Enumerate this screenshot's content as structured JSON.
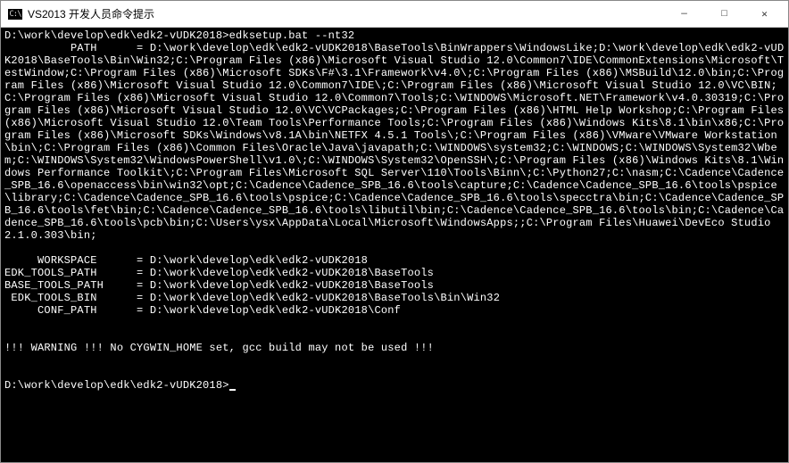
{
  "window": {
    "icon_label": "C:\\",
    "title": "VS2013 开发人员命令提示"
  },
  "controls": {
    "minimize": "—",
    "maximize": "□",
    "close": "✕"
  },
  "terminal": {
    "line_command": "D:\\work\\develop\\edk\\edk2-vUDK2018>edksetup.bat --nt32",
    "path_label": "          PATH      = ",
    "path_value": "D:\\work\\develop\\edk\\edk2-vUDK2018\\BaseTools\\BinWrappers\\WindowsLike;D:\\work\\develop\\edk\\edk2-vUDK2018\\BaseTools\\Bin\\Win32;C:\\Program Files (x86)\\Microsoft Visual Studio 12.0\\Common7\\IDE\\CommonExtensions\\Microsoft\\TestWindow;C:\\Program Files (x86)\\Microsoft SDKs\\F#\\3.1\\Framework\\v4.0\\;C:\\Program Files (x86)\\MSBuild\\12.0\\bin;C:\\Program Files (x86)\\Microsoft Visual Studio 12.0\\Common7\\IDE\\;C:\\Program Files (x86)\\Microsoft Visual Studio 12.0\\VC\\BIN;C:\\Program Files (x86)\\Microsoft Visual Studio 12.0\\Common7\\Tools;C:\\WINDOWS\\Microsoft.NET\\Framework\\v4.0.30319;C:\\Program Files (x86)\\Microsoft Visual Studio 12.0\\VC\\VCPackages;C:\\Program Files (x86)\\HTML Help Workshop;C:\\Program Files (x86)\\Microsoft Visual Studio 12.0\\Team Tools\\Performance Tools;C:\\Program Files (x86)\\Windows Kits\\8.1\\bin\\x86;C:\\Program Files (x86)\\Microsoft SDKs\\Windows\\v8.1A\\bin\\NETFX 4.5.1 Tools\\;C:\\Program Files (x86)\\VMware\\VMware Workstation\\bin\\;C:\\Program Files (x86)\\Common Files\\Oracle\\Java\\javapath;C:\\WINDOWS\\system32;C:\\WINDOWS;C:\\WINDOWS\\System32\\Wbem;C:\\WINDOWS\\System32\\WindowsPowerShell\\v1.0\\;C:\\WINDOWS\\System32\\OpenSSH\\;C:\\Program Files (x86)\\Windows Kits\\8.1\\Windows Performance Toolkit\\;C:\\Program Files\\Microsoft SQL Server\\110\\Tools\\Binn\\;C:\\Python27;C:\\nasm;C:\\Cadence\\Cadence_SPB_16.6\\openaccess\\bin\\win32\\opt;C:\\Cadence\\Cadence_SPB_16.6\\tools\\capture;C:\\Cadence\\Cadence_SPB_16.6\\tools\\pspice\\library;C:\\Cadence\\Cadence_SPB_16.6\\tools\\pspice;C:\\Cadence\\Cadence_SPB_16.6\\tools\\specctra\\bin;C:\\Cadence\\Cadence_SPB_16.6\\tools\\fet\\bin;C:\\Cadence\\Cadence_SPB_16.6\\tools\\libutil\\bin;C:\\Cadence\\Cadence_SPB_16.6\\tools\\bin;C:\\Cadence\\Cadence_SPB_16.6\\tools\\pcb\\bin;C:\\Users\\ysx\\AppData\\Local\\Microsoft\\WindowsApps;;C:\\Program Files\\Huawei\\DevEco Studio 2.1.0.303\\bin;",
    "env": [
      {
        "label": "     WORKSPACE      = ",
        "value": "D:\\work\\develop\\edk\\edk2-vUDK2018"
      },
      {
        "label": "EDK_TOOLS_PATH      = ",
        "value": "D:\\work\\develop\\edk\\edk2-vUDK2018\\BaseTools"
      },
      {
        "label": "BASE_TOOLS_PATH     = ",
        "value": "D:\\work\\develop\\edk\\edk2-vUDK2018\\BaseTools"
      },
      {
        "label": " EDK_TOOLS_BIN      = ",
        "value": "D:\\work\\develop\\edk\\edk2-vUDK2018\\BaseTools\\Bin\\Win32"
      },
      {
        "label": "     CONF_PATH      = ",
        "value": "D:\\work\\develop\\edk\\edk2-vUDK2018\\Conf"
      }
    ],
    "warning": "!!! WARNING !!! No CYGWIN_HOME set, gcc build may not be used !!!",
    "prompt": "D:\\work\\develop\\edk\\edk2-vUDK2018>"
  }
}
